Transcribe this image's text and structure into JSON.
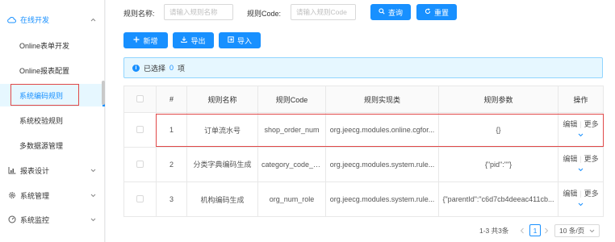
{
  "sidebar": {
    "groups": [
      {
        "label": "在线开发",
        "icon": "cloud-icon",
        "expanded": true
      },
      {
        "label": "报表设计",
        "icon": "bar-chart-icon"
      },
      {
        "label": "系统管理",
        "icon": "gear-icon"
      },
      {
        "label": "系统监控",
        "icon": "dashboard-icon"
      }
    ],
    "sub_items": [
      {
        "label": "Online表单开发"
      },
      {
        "label": "Online报表配置"
      },
      {
        "label": "系统编码规则",
        "selected": true
      },
      {
        "label": "系统校验规则"
      },
      {
        "label": "多数据源管理"
      }
    ]
  },
  "search": {
    "rule_name_label": "规则名称:",
    "rule_name_placeholder": "请输入规则名称",
    "rule_code_label": "规则Code:",
    "rule_code_placeholder": "请输入规则Code",
    "query_label": "查询",
    "reset_label": "重置"
  },
  "toolbar": {
    "add_label": "新增",
    "export_label": "导出",
    "import_label": "导入"
  },
  "selection": {
    "text_prefix": "已选择",
    "count": "0",
    "text_suffix": "项"
  },
  "table": {
    "columns": [
      "#",
      "规则名称",
      "规则Code",
      "规则实现类",
      "规则参数",
      "操作"
    ],
    "rows": [
      {
        "index": "1",
        "name": "订单流水号",
        "code": "shop_order_num",
        "impl": "org.jeecg.modules.online.cgfor...",
        "params": "{}"
      },
      {
        "index": "2",
        "name": "分类字典编码生成",
        "code": "category_code_rule",
        "impl": "org.jeecg.modules.system.rule...",
        "params": "{\"pid\":\"\"}"
      },
      {
        "index": "3",
        "name": "机构编码生成",
        "code": "org_num_role",
        "impl": "org.jeecg.modules.system.rule...",
        "params": "{\"parentId\":\"c6d7cb4deeac411cb..."
      }
    ],
    "action_edit": "编辑",
    "action_more": "更多"
  },
  "pagination": {
    "total_text": "1-3 共3条",
    "current_page": "1",
    "page_size": "10 条/页"
  },
  "colors": {
    "primary": "#1890ff",
    "highlight_border": "#e04848"
  }
}
